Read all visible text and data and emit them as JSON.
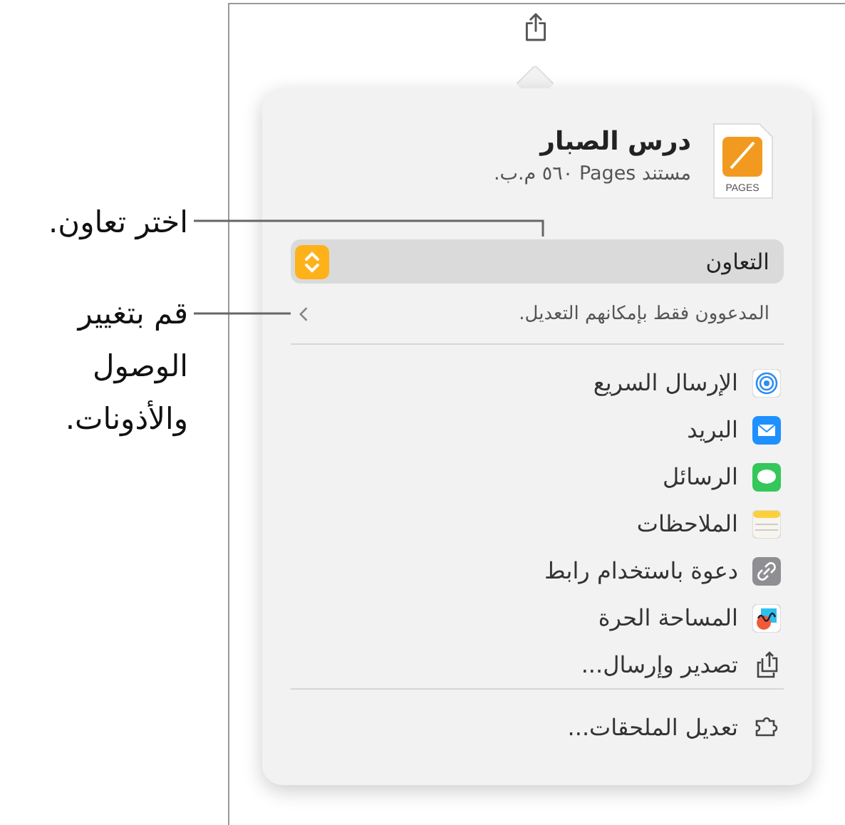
{
  "document": {
    "title": "درس الصبار",
    "subtitle": "مستند Pages ٥٦٠ م.ب.",
    "icon_label": "PAGES"
  },
  "collaboration": {
    "label": "التعاون",
    "access": "المدعوون فقط بإمكانهم التعديل."
  },
  "share_items": [
    {
      "label": "الإرسال السريع",
      "kind": "airdrop"
    },
    {
      "label": "البريد",
      "kind": "mail"
    },
    {
      "label": "الرسائل",
      "kind": "messages"
    },
    {
      "label": "الملاحظات",
      "kind": "notes"
    },
    {
      "label": "دعوة باستخدام رابط",
      "kind": "link"
    },
    {
      "label": "المساحة الحرة",
      "kind": "freeform"
    },
    {
      "label": "تصدير وإرسال...",
      "kind": "export"
    }
  ],
  "footer_item": {
    "label": "تعديل الملحقات...",
    "kind": "extensions"
  },
  "callouts": [
    {
      "text": "اختر تعاون."
    },
    {
      "text": "قم بتغيير الوصول والأذونات."
    }
  ]
}
